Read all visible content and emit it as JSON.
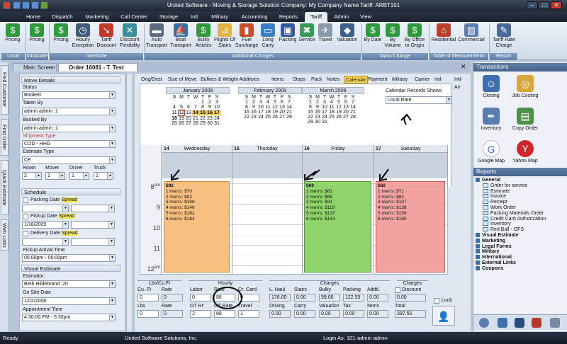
{
  "window": {
    "title": "United Software - Moving & Storage Solution   Company: My Company Name  Tariff: ARBT101"
  },
  "ribbon_tabs": [
    "Home",
    "Dispatch",
    "Marketing",
    "Call Center",
    "Storage",
    "Intl",
    "Military",
    "Accounting",
    "Reports",
    "Tariff",
    "Admin",
    "View"
  ],
  "ribbon_buttons": {
    "pricing_local": "Pricing",
    "pricing_intra": "Pricing",
    "pricing": "Pricing",
    "hourly": "Hourly Exception",
    "tariff_discount": "Tariff Discount",
    "discount_flex": "Discount Flexibility",
    "auto": "Auto Transport",
    "boat": "Boat Transport",
    "bulky": "Bulky Articles",
    "flights": "Flights Of Stairs",
    "fuel": "Fuel Surcharge",
    "longcarry": "Long Carry",
    "packing": "Packing",
    "service": "Service",
    "travel": "Travel",
    "valuation": "Valuation",
    "bydate": "By Date",
    "byvolume": "By Volume",
    "byoffice": "By Office to Origin",
    "residential": "Residential",
    "commercial": "Commercial",
    "tariffrate": "Tariff Rate Charge"
  },
  "ribbon_groups": {
    "local": "Local",
    "intrastate": "Intrastate",
    "interstate": "Interstate",
    "additional": "Additional Chrages",
    "mass": "Mass Change",
    "measurements": "Table of Measurements",
    "report": "Report"
  },
  "side_tabs": [
    "Find Customer",
    "Find Order",
    "Quick Estimate",
    "Web Links"
  ],
  "doc_tabs": {
    "main": "Main Screen",
    "order": "Order 16081 - T. Test"
  },
  "form": {
    "move_details": "Move Details",
    "status_label": "Status",
    "status": "Booked",
    "taken_by_label": "Taken By",
    "taken_by": "admin admin :1",
    "booked_by_label": "Booked By",
    "booked_by": "admin admin :1",
    "shipment_type_label": "Shipment Type",
    "shipment_type": "COD - HHG",
    "estimate_type_label": "Estimate Type",
    "estimate_type": "CE",
    "room_label": "Room",
    "mover_label": "Mover",
    "driver_label": "Driver",
    "truck_label": "Truck",
    "room": "2",
    "mover": "1",
    "driver": "1",
    "truck": "1",
    "schedule": "Schedule",
    "packing_date": "Packing Date",
    "pickup_date": "Pickup Date",
    "delivery_date": "Delivery Date",
    "spread": "Spread",
    "pickup_value": "1/18/2009",
    "pickup_arrival_label": "Pickup Arrival Time",
    "pickup_arrival": "05:00pm - 06:00pm",
    "visual_estimate": "Visual Estimate",
    "estimator_label": "Estimator:",
    "estimator": "Beth Hildebrand :20",
    "on_site_label": "On Site Date",
    "on_site": "12/2/2008",
    "appointment_label": "Appointment Time",
    "appointment": "4:30:00 PM - 5:30pm"
  },
  "sub_tabs": [
    "Orig/Dest",
    "Size of Move",
    "Bulkies & Weight Additives",
    "Items",
    "Stops",
    "Pack",
    "Notes",
    "Calendar",
    "Payment",
    "Military",
    "Carrier",
    "Intl-Sea",
    "Intl-Air"
  ],
  "calendar": {
    "dow": [
      "S",
      "M",
      "T",
      "W",
      "T",
      "F",
      "S"
    ],
    "months": [
      {
        "name": "January 2009",
        "rows": [
          [
            "",
            "",
            "",
            "",
            "1",
            "2",
            "3"
          ],
          [
            "4",
            "5",
            "6",
            "7",
            "8",
            "9",
            "10"
          ],
          [
            "11",
            "12",
            "13",
            "14",
            "15",
            "16",
            "17"
          ],
          [
            "18",
            "19",
            "20",
            "21",
            "22",
            "23",
            "24"
          ],
          [
            "25",
            "26",
            "27",
            "28",
            "29",
            "30",
            "31"
          ]
        ]
      },
      {
        "name": "February 2009",
        "rows": [
          [
            "1",
            "2",
            "3",
            "4",
            "5",
            "6",
            "7"
          ],
          [
            "8",
            "9",
            "10",
            "11",
            "12",
            "13",
            "14"
          ],
          [
            "15",
            "16",
            "17",
            "18",
            "19",
            "20",
            "21"
          ],
          [
            "22",
            "23",
            "24",
            "25",
            "26",
            "27",
            "28"
          ]
        ]
      },
      {
        "name": "March 2009",
        "rows": [
          [
            "1",
            "2",
            "3",
            "4",
            "5",
            "6",
            "7"
          ],
          [
            "8",
            "9",
            "10",
            "11",
            "12",
            "13",
            "14"
          ],
          [
            "15",
            "16",
            "17",
            "18",
            "19",
            "20",
            "21"
          ],
          [
            "22",
            "23",
            "24",
            "25",
            "26",
            "27",
            "28"
          ],
          [
            "29",
            "30",
            "31",
            "",
            "",
            "",
            ""
          ]
        ]
      }
    ],
    "records_label": "Calendar Records Shows",
    "records_value": "Local Rate",
    "days": [
      {
        "num": "14",
        "name": "Wednesday",
        "price": "$82",
        "lines": [
          "1 men's: $70",
          "2 men's: $82",
          "3 men's: $108",
          "4 men's: $140",
          "5 men's: $162",
          "6 men's: $184"
        ]
      },
      {
        "num": "15",
        "name": "Thursday",
        "price": "",
        "lines": []
      },
      {
        "num": "16",
        "name": "Friday",
        "price": "$69",
        "lines": [
          "1 men's: $61",
          "2 men's: $69",
          "3 men's: $91",
          "4 men's: $119",
          "5 men's: $137",
          "6 men's: $144"
        ]
      },
      {
        "num": "17",
        "name": "Saturday",
        "price": "$82",
        "lines": [
          "1 men's: $71",
          "2 men's: $82",
          "3 men's: $107",
          "4 men's: $138",
          "5 men's: $159",
          "6 men's: $180"
        ]
      }
    ],
    "times": [
      "8",
      "9",
      "10",
      "11",
      "12"
    ],
    "time_suffix": [
      "am",
      "",
      "",
      "",
      "pm"
    ]
  },
  "bottom": {
    "lbs_cuft": "Lbs/Cu.Ft",
    "hourly": "Hourly",
    "charges": "Charges",
    "charges2": "Charges",
    "cu_ft": "Cu. Ft",
    "rate1": "Rate",
    "lbs": "Lbs",
    "rate2": "Rate",
    "labor": "Labor",
    "rate3": "Rate",
    "cr_card": "Cr. Card",
    "ot_hr": "OT Hr'",
    "ot_rate": "OT Rate",
    "travel": "Travel",
    "l_haul": "L. Haul",
    "stairs": "Stairs",
    "bulky": "Bulky",
    "packing": "Packing",
    "addtl": "Addtl.",
    "driving": "Driving",
    "carry": "Carry",
    "valuation": "Valuation",
    "tax": "Tax",
    "items": "Items",
    "discount": "Discount",
    "total": "Total",
    "lock": "Lock",
    "v_cuft": "0",
    "v_rate1": "0",
    "v_lbs": "0",
    "v_rate2": "0",
    "v_labor": "0",
    "v_rate3": "88",
    "v_crcard": "0",
    "v_othr": "2",
    "v_otrate": "88",
    "v_travel": "1",
    "v_lhaul": "176.00",
    "v_stairs": "0.00",
    "v_bulky": "99.00",
    "v_packing": "122.55",
    "v_addtl": "0.00",
    "v_driving": "0.00",
    "v_carry": "0.00",
    "v_valuation": "0.00",
    "v_tax": "0.00",
    "v_items": "0.00",
    "v_discount": "0.00",
    "v_total": "397.55"
  },
  "right": {
    "transactions": "Transactions",
    "closing": "Closing",
    "job_costing": "Job Costing",
    "inventory": "Inventory",
    "copy_order": "Copy Order",
    "google_map": "Google Map",
    "yahoo_map": "Yahoo Map",
    "reports": "Reports",
    "general": "General",
    "general_items": [
      "Order for service",
      "Estimate",
      "Invoice",
      "Receipt",
      "Work Order",
      "Packing Materials Order",
      "Credit Card Authorization",
      "Inventory",
      "Red Ball - OFS"
    ],
    "other_groups": [
      "Visual Estimate",
      "Marketing",
      "Legal Forms",
      "Military",
      "International",
      "External Links",
      "Coupons"
    ]
  },
  "status": {
    "ready": "Ready",
    "company": "United Software Solutions, Inc.",
    "login": "Login As: 101-admin admin"
  }
}
